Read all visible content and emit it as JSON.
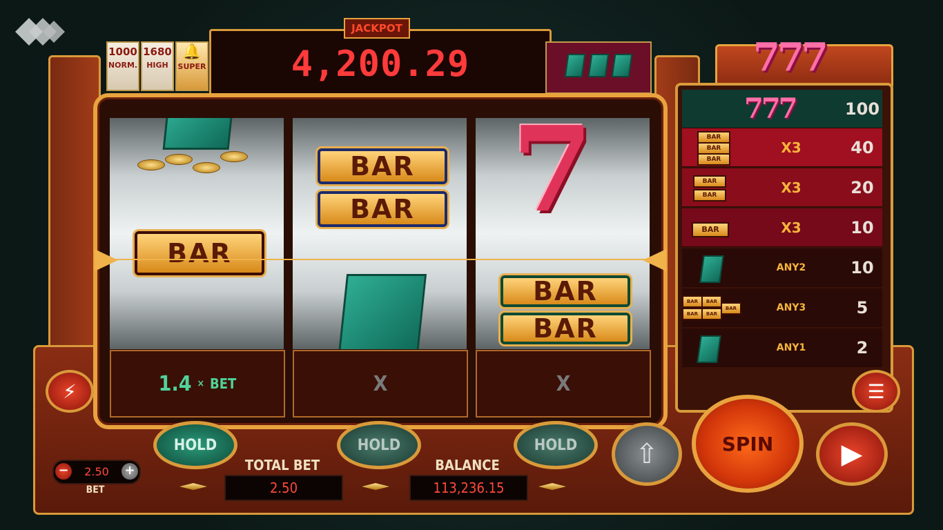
{
  "jackpot": {
    "label": "JACKPOT",
    "value": "4,200.29"
  },
  "tiers": [
    {
      "top": "1000",
      "bottom": "NORM."
    },
    {
      "top": "1680",
      "bottom": "HIGH"
    },
    {
      "top": "",
      "bottom": "SUPER"
    }
  ],
  "reels": {
    "symbols": {
      "bar": "BAR",
      "seven": "7"
    },
    "results": {
      "reel1": {
        "multiplier": "1.4",
        "times": "×",
        "suffix": "BET"
      },
      "reel2": "X",
      "reel3": "X"
    }
  },
  "holds": [
    "HOLD",
    "HOLD",
    "HOLD"
  ],
  "total_bet": {
    "label": "TOTAL BET",
    "value": "2.50"
  },
  "balance": {
    "label": "BALANCE",
    "value": "113,236.15"
  },
  "bet_control": {
    "value": "2.50",
    "label": "BET",
    "minus": "−",
    "plus": "+"
  },
  "spin": {
    "label": "SPIN"
  },
  "paytable": {
    "header": "777",
    "rows": [
      {
        "symbol": "777",
        "mult": "",
        "payout": "100"
      },
      {
        "symbol": "triple-bar",
        "mult": "X3",
        "payout": "40"
      },
      {
        "symbol": "double-bar",
        "mult": "X3",
        "payout": "20"
      },
      {
        "symbol": "single-bar",
        "mult": "X3",
        "payout": "10"
      },
      {
        "symbol": "card",
        "mult": "ANY2",
        "payout": "10"
      },
      {
        "symbol": "any-bar",
        "mult": "ANY3",
        "payout": "5"
      },
      {
        "symbol": "card",
        "mult": "ANY1",
        "payout": "2"
      }
    ]
  },
  "colors": {
    "accent": "#e8a33e",
    "jackpot": "#ff3b3b",
    "green": "#4fd39a"
  }
}
